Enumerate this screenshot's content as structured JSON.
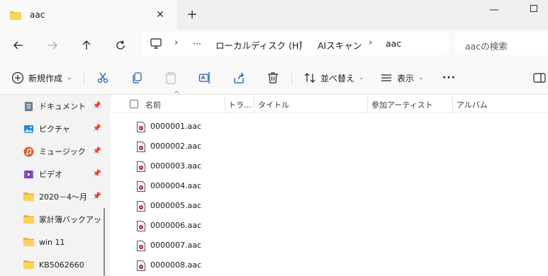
{
  "tab": {
    "title": "aac",
    "close": "✕",
    "new_tab": "+"
  },
  "window": {
    "minimize": "—"
  },
  "address": {
    "ellipsis": "···",
    "segments": [
      "ローカルディスク (H)",
      "AIスキャン",
      "aac"
    ],
    "separator": "›"
  },
  "search": {
    "placeholder": "aacの検索"
  },
  "commands": {
    "new": "新規作成",
    "sort": "並べ替え",
    "view": "表示",
    "more": "···"
  },
  "sidebar": {
    "items": [
      {
        "label": "ドキュメント",
        "icon": "document-icon",
        "pinned": true
      },
      {
        "label": "ピクチャ",
        "icon": "picture-icon",
        "pinned": true
      },
      {
        "label": "ミュージック",
        "icon": "music-icon",
        "pinned": true
      },
      {
        "label": "ビデオ",
        "icon": "video-icon",
        "pinned": true
      },
      {
        "label": "2020－4～月",
        "icon": "folder-icon",
        "pinned": true
      },
      {
        "label": "家計簿バックアップ",
        "icon": "folder-icon",
        "pinned": false
      },
      {
        "label": "win 11",
        "icon": "folder-icon",
        "pinned": false
      },
      {
        "label": "KB5062660",
        "icon": "folder-icon",
        "pinned": false
      }
    ]
  },
  "columns": {
    "sort_caret": "^",
    "name": "名前",
    "track": "トラ...",
    "title": "タイトル",
    "artist": "参加アーティスト",
    "album": "アルバム"
  },
  "files": [
    "0000001.aac",
    "0000002.aac",
    "0000003.aac",
    "0000004.aac",
    "0000005.aac",
    "0000006.aac",
    "0000007.aac",
    "0000008.aac"
  ],
  "colors": {
    "folder": "#f4c542",
    "accent": "#0067c0",
    "media_icon": "#b5122e"
  }
}
